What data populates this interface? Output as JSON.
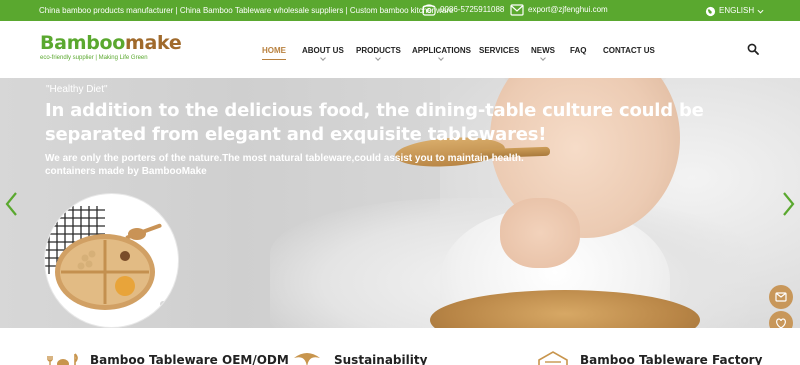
{
  "topbar": {
    "tagline": "China bamboo products manufacturer | China Bamboo Tableware wholesale suppliers | Custom bamboo kitchenware",
    "phone": "0086-5725911088",
    "email": "export@zjfenghui.com",
    "language": "ENGLISH",
    "bg_color": "#5aa82f"
  },
  "header": {
    "logo": {
      "part1": "Bamboo",
      "part2": "make",
      "tagline": "eco-friendly supplier | Making Life Green"
    },
    "nav": [
      {
        "label": "HOME",
        "active": true,
        "dropdown": false
      },
      {
        "label": "ABOUT US",
        "active": false,
        "dropdown": true
      },
      {
        "label": "PRODUCTS",
        "active": false,
        "dropdown": true
      },
      {
        "label": "APPLICATIONS",
        "active": false,
        "dropdown": true
      },
      {
        "label": "SERVICES",
        "active": false,
        "dropdown": false
      },
      {
        "label": "NEWS",
        "active": false,
        "dropdown": true
      },
      {
        "label": "FAQ",
        "active": false,
        "dropdown": false
      },
      {
        "label": "CONTACT US",
        "active": false,
        "dropdown": false
      }
    ],
    "accent_color": "#b8813f",
    "search_icon": "search-icon"
  },
  "hero": {
    "quote": "\"Healthy Diet\"",
    "headline": "In addition to the delicious food, the dining-table culture could be separated from elegant and exquisite tablewares!",
    "sub_line1": "We are only the porters of the nature.The most natural tableware,could assist you to maintain health.",
    "sub_line2": "containers made by BambooMake"
  },
  "floating": {
    "mail_icon": "mail-icon",
    "heart_icon": "heart-icon",
    "up_icon": "arrow-up-icon"
  },
  "features": [
    {
      "icon": "fork-knife-icon",
      "title": "Bamboo Tableware OEM/ODM"
    },
    {
      "icon": "leaf-icon",
      "title": "Sustainability"
    },
    {
      "icon": "factory-icon",
      "title": "Bamboo Tableware Factory"
    }
  ]
}
